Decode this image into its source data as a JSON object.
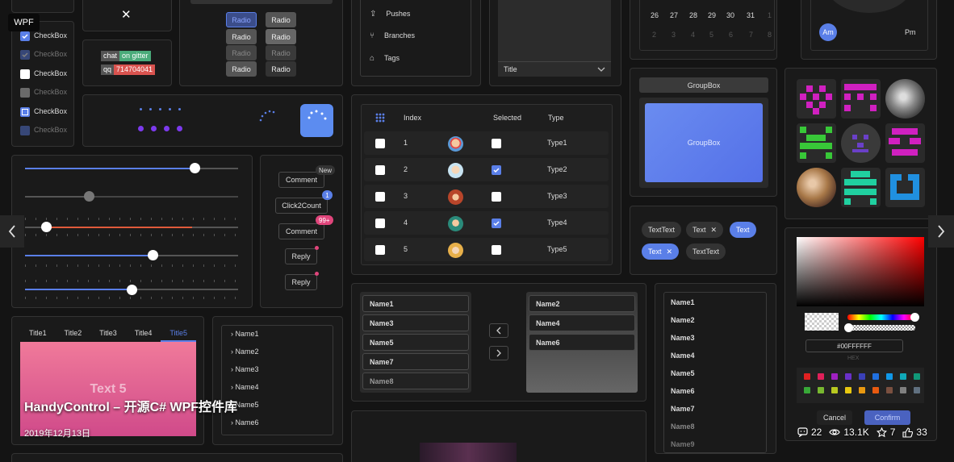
{
  "badge": "WPF",
  "caption": {
    "title": "HandyControl – 开源C# WPF控件库",
    "date": "2019年12月13日"
  },
  "stats": {
    "comments": "22",
    "views": "13.1K",
    "stars": "7",
    "likes": "33"
  },
  "checkboxes": [
    "CheckBox",
    "CheckBox",
    "CheckBox",
    "CheckBox",
    "CheckBox",
    "CheckBox"
  ],
  "close_glyph": "✕",
  "chips": {
    "chat_k": "chat",
    "chat_v": "on gitter",
    "qq_k": "qq",
    "qq_v": "714704041"
  },
  "radios": [
    "Radio",
    "Radio",
    "Radio",
    "Radio",
    "Radio",
    "Radio",
    "Radio",
    "Radio"
  ],
  "side_menu": [
    "Pushes",
    "Branches",
    "Tags"
  ],
  "combo": {
    "title": "Title"
  },
  "calendar": {
    "row1": [
      "26",
      "27",
      "28",
      "29",
      "30",
      "31",
      "1"
    ],
    "row2": [
      "2",
      "3",
      "4",
      "5",
      "6",
      "7",
      "8"
    ]
  },
  "clock": {
    "am": "Am",
    "pm": "Pm"
  },
  "groupbox": {
    "title": "GroupBox",
    "content": "GroupBox"
  },
  "table": {
    "headers": [
      "Index",
      "Selected",
      "Type"
    ],
    "rows": [
      {
        "index": "1",
        "selected": false,
        "type": "Type1"
      },
      {
        "index": "2",
        "selected": true,
        "type": "Type2"
      },
      {
        "index": "3",
        "selected": false,
        "type": "Type3"
      },
      {
        "index": "4",
        "selected": true,
        "type": "Type4"
      },
      {
        "index": "5",
        "selected": false,
        "type": "Type5"
      }
    ]
  },
  "badges": {
    "comment": "Comment",
    "new": "New",
    "click2count": "Click2Count",
    "count": "1",
    "comment2": "Comment",
    "overflow": "99+",
    "reply": "Reply",
    "reply2": "Reply"
  },
  "tabs": {
    "items": [
      "Title1",
      "Title2",
      "Title3",
      "Title4",
      "Title5"
    ],
    "content": "Text 5"
  },
  "tree": [
    "Name1",
    "Name2",
    "Name3",
    "Name4",
    "Name5",
    "Name6"
  ],
  "transfer": {
    "left": [
      "Name1",
      "Name3",
      "Name5",
      "Name7",
      "Name8"
    ],
    "right": [
      "Name2",
      "Name4",
      "Name6"
    ]
  },
  "listbox": [
    "Name1",
    "Name2",
    "Name3",
    "Name4",
    "Name5",
    "Name6",
    "Name7",
    "Name8",
    "Name9"
  ],
  "tags": [
    "TextText",
    "Text",
    "Text",
    "Text",
    "TextText"
  ],
  "colorpicker": {
    "hex": "#00FFFFFF",
    "mode": "HEX",
    "cancel": "Cancel",
    "confirm": "Confirm"
  },
  "colors": {
    "accent": "#5a7fe8",
    "bg": "#141414",
    "card": "#1a1a1a"
  }
}
